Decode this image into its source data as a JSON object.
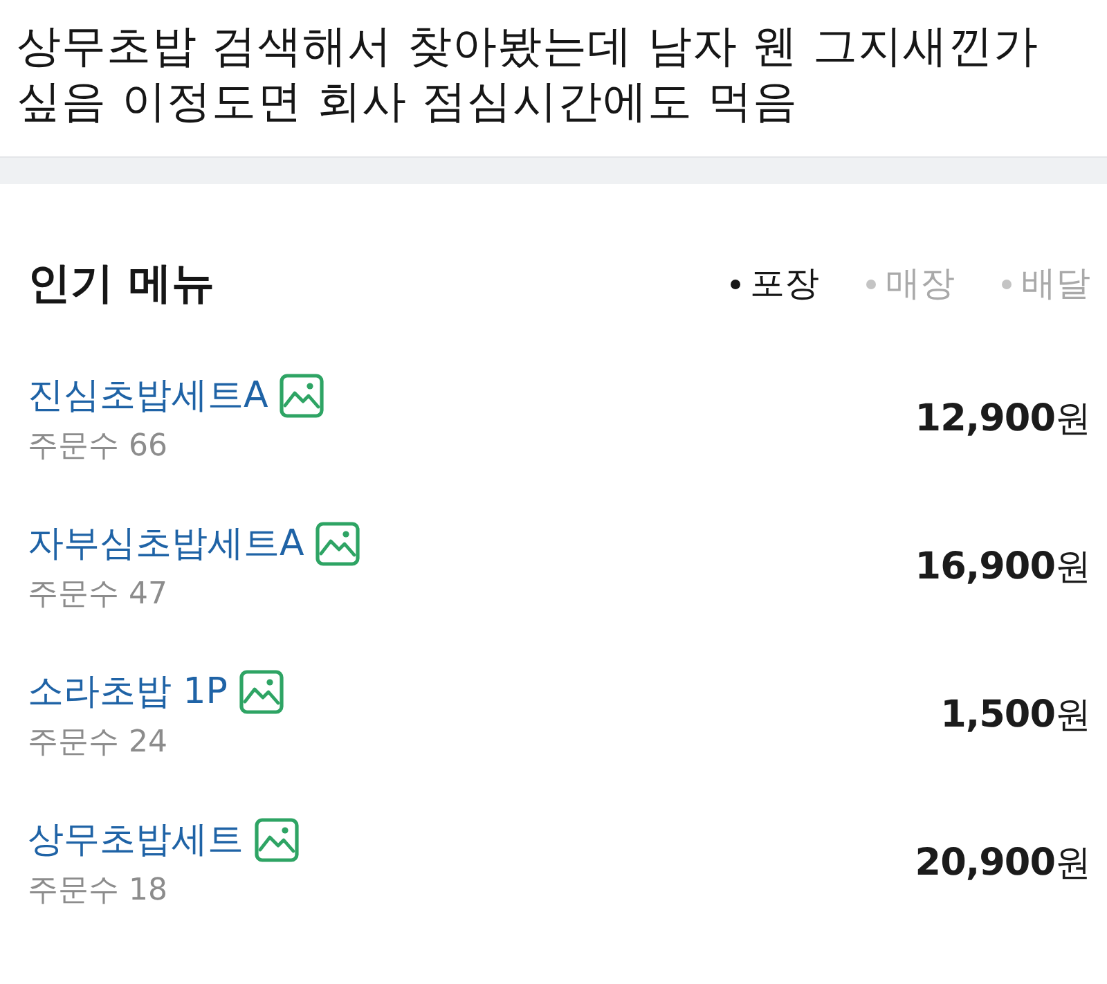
{
  "post": {
    "text": "상무초밥 검색해서 찾아봤는데 남자 웬 그지새낀가 싶음 이정도면 회사 점심시간에도 먹음"
  },
  "popular_menu": {
    "title": "인기 메뉴",
    "filters": [
      {
        "label": "포장",
        "selected": true
      },
      {
        "label": "매장",
        "selected": false
      },
      {
        "label": "배달",
        "selected": false
      }
    ],
    "items": [
      {
        "name": "진심초밥세트A",
        "has_photo": true,
        "orders": "주문수 66",
        "price": "**12,900**원"
      },
      {
        "name": "자부심초밥세트A",
        "has_photo": true,
        "orders": "주문수 47",
        "price": "**16,900**원"
      },
      {
        "name": "소라초밥 1P",
        "has_photo": true,
        "orders": "주문수 24",
        "price": "**1,500**원"
      },
      {
        "name": "상무초밥세트",
        "has_photo": true,
        "orders": "주문수 18",
        "price": "**20,900**원"
      }
    ]
  }
}
